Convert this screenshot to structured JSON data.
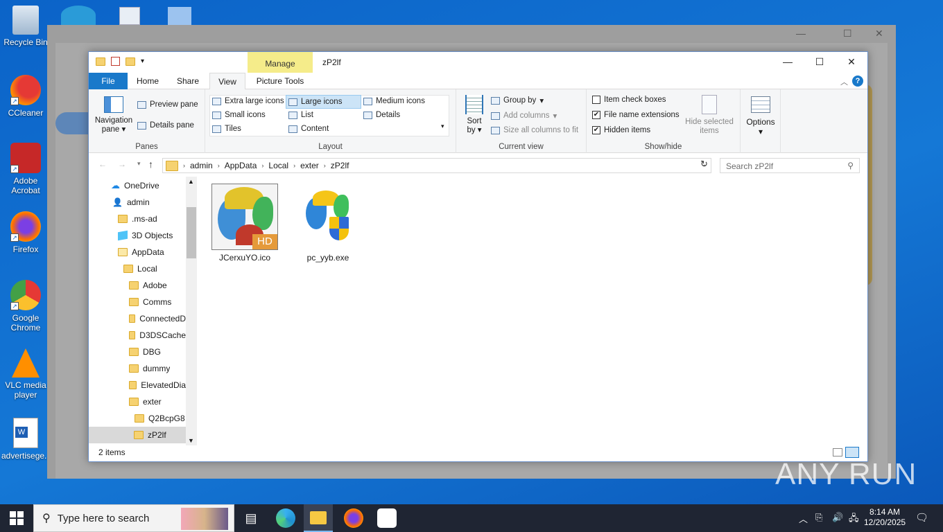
{
  "desktop": {
    "icons": [
      {
        "label": "Recycle Bin"
      },
      {
        "label": "CCleaner"
      },
      {
        "label": "Adobe Acrobat"
      },
      {
        "label": "Firefox"
      },
      {
        "label": "Google Chrome"
      },
      {
        "label": "VLC media player"
      },
      {
        "label": "advertisege..."
      }
    ]
  },
  "window": {
    "title": "zP2lf",
    "manage_tab": "Manage",
    "picture_tools_tab": "Picture Tools",
    "tabs": {
      "file": "File",
      "home": "Home",
      "share": "Share",
      "view": "View"
    }
  },
  "ribbon": {
    "panes": {
      "label": "Panes",
      "navigation_pane": "Navigation pane",
      "preview_pane": "Preview pane",
      "details_pane": "Details pane"
    },
    "layout": {
      "label": "Layout",
      "options": [
        "Extra large icons",
        "Large icons",
        "Medium icons",
        "Small icons",
        "List",
        "Details",
        "Tiles",
        "Content"
      ],
      "selected": "Large icons"
    },
    "current_view": {
      "label": "Current view",
      "sort_by": "Sort by",
      "group_by": "Group by",
      "add_columns": "Add columns",
      "size_columns": "Size all columns to fit"
    },
    "show_hide": {
      "label": "Show/hide",
      "item_check_boxes": "Item check boxes",
      "file_name_extensions": "File name extensions",
      "hidden_items": "Hidden items",
      "hide_selected": "Hide selected items",
      "checks": {
        "item_check_boxes": false,
        "file_name_extensions": true,
        "hidden_items": true
      }
    },
    "options": "Options"
  },
  "address": {
    "crumbs": [
      "admin",
      "AppData",
      "Local",
      "exter",
      "zP2lf"
    ],
    "search_placeholder": "Search zP2lf"
  },
  "nav_tree": [
    {
      "label": "OneDrive",
      "icon": "cloud-icon"
    },
    {
      "label": "admin",
      "icon": "user-icon"
    },
    {
      "label": ".ms-ad",
      "icon": "folder-icon"
    },
    {
      "label": "3D Objects",
      "icon": "cube-icon"
    },
    {
      "label": "AppData",
      "icon": "folder-icon"
    },
    {
      "label": "Local",
      "icon": "folder-icon"
    },
    {
      "label": "Adobe",
      "icon": "folder-icon"
    },
    {
      "label": "Comms",
      "icon": "folder-icon"
    },
    {
      "label": "ConnectedD",
      "icon": "folder-icon"
    },
    {
      "label": "D3DSCache",
      "icon": "folder-icon"
    },
    {
      "label": "DBG",
      "icon": "folder-icon"
    },
    {
      "label": "dummy",
      "icon": "folder-icon"
    },
    {
      "label": "ElevatedDia",
      "icon": "folder-icon"
    },
    {
      "label": "exter",
      "icon": "folder-icon"
    },
    {
      "label": "Q2BcpG8",
      "icon": "folder-icon"
    },
    {
      "label": "zP2lf",
      "icon": "folder-icon"
    }
  ],
  "files": [
    {
      "name": "JCerxuYO.ico",
      "badge": "HD"
    },
    {
      "name": "pc_yyb.exe"
    }
  ],
  "status": "2 items",
  "taskbar": {
    "search_placeholder": "Type here to search",
    "time": "8:14 AM",
    "date": "12/20/2025"
  },
  "watermark": "ANY RUN"
}
